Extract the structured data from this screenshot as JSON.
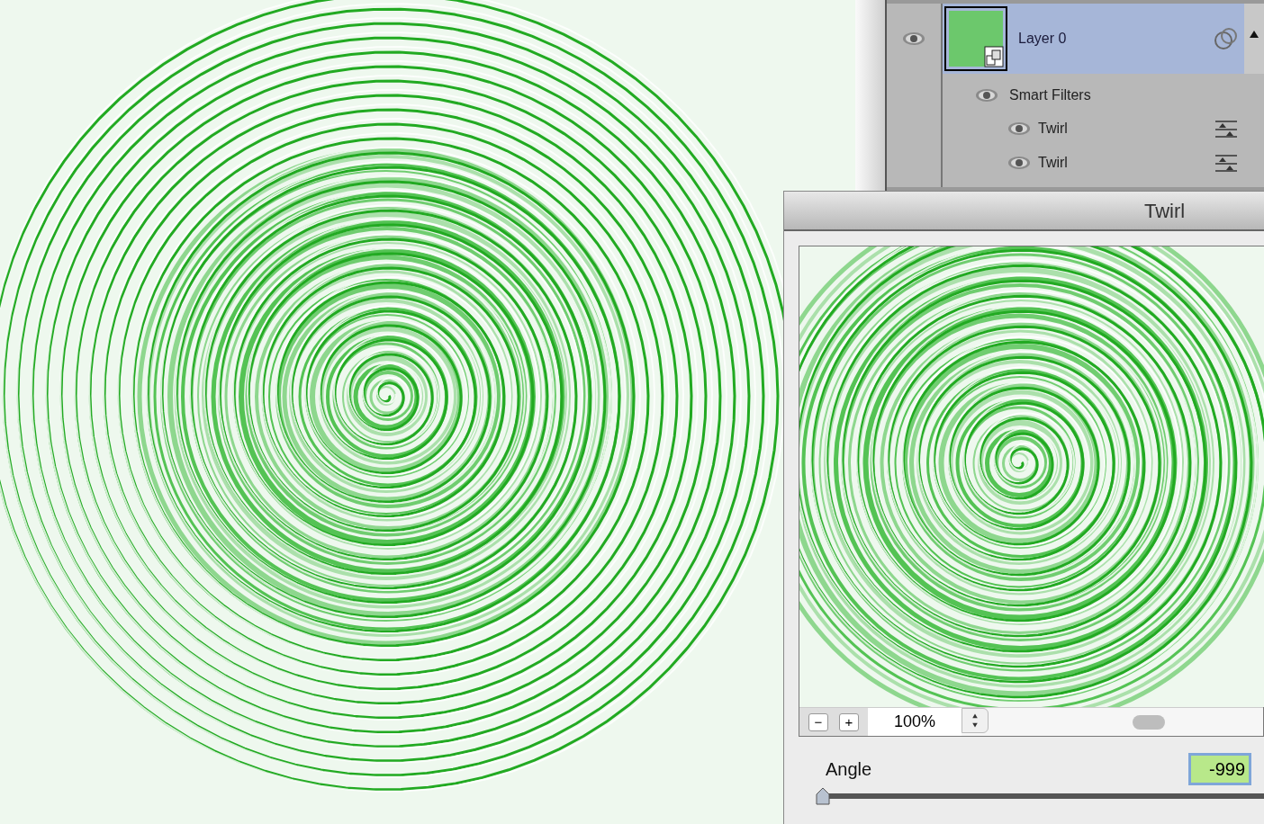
{
  "layers": {
    "layer": {
      "name": "Layer 0",
      "visible": true,
      "selected": true
    },
    "smart_filters": {
      "label": "Smart Filters",
      "visible": true
    },
    "filters": [
      {
        "name": "Twirl",
        "visible": true
      },
      {
        "name": "Twirl",
        "visible": true
      }
    ]
  },
  "dialog": {
    "title": "Twirl",
    "zoom_out": "−",
    "zoom_in": "+",
    "zoom": "100%",
    "angle": {
      "label": "Angle",
      "value": "-999",
      "level": 0
    }
  }
}
